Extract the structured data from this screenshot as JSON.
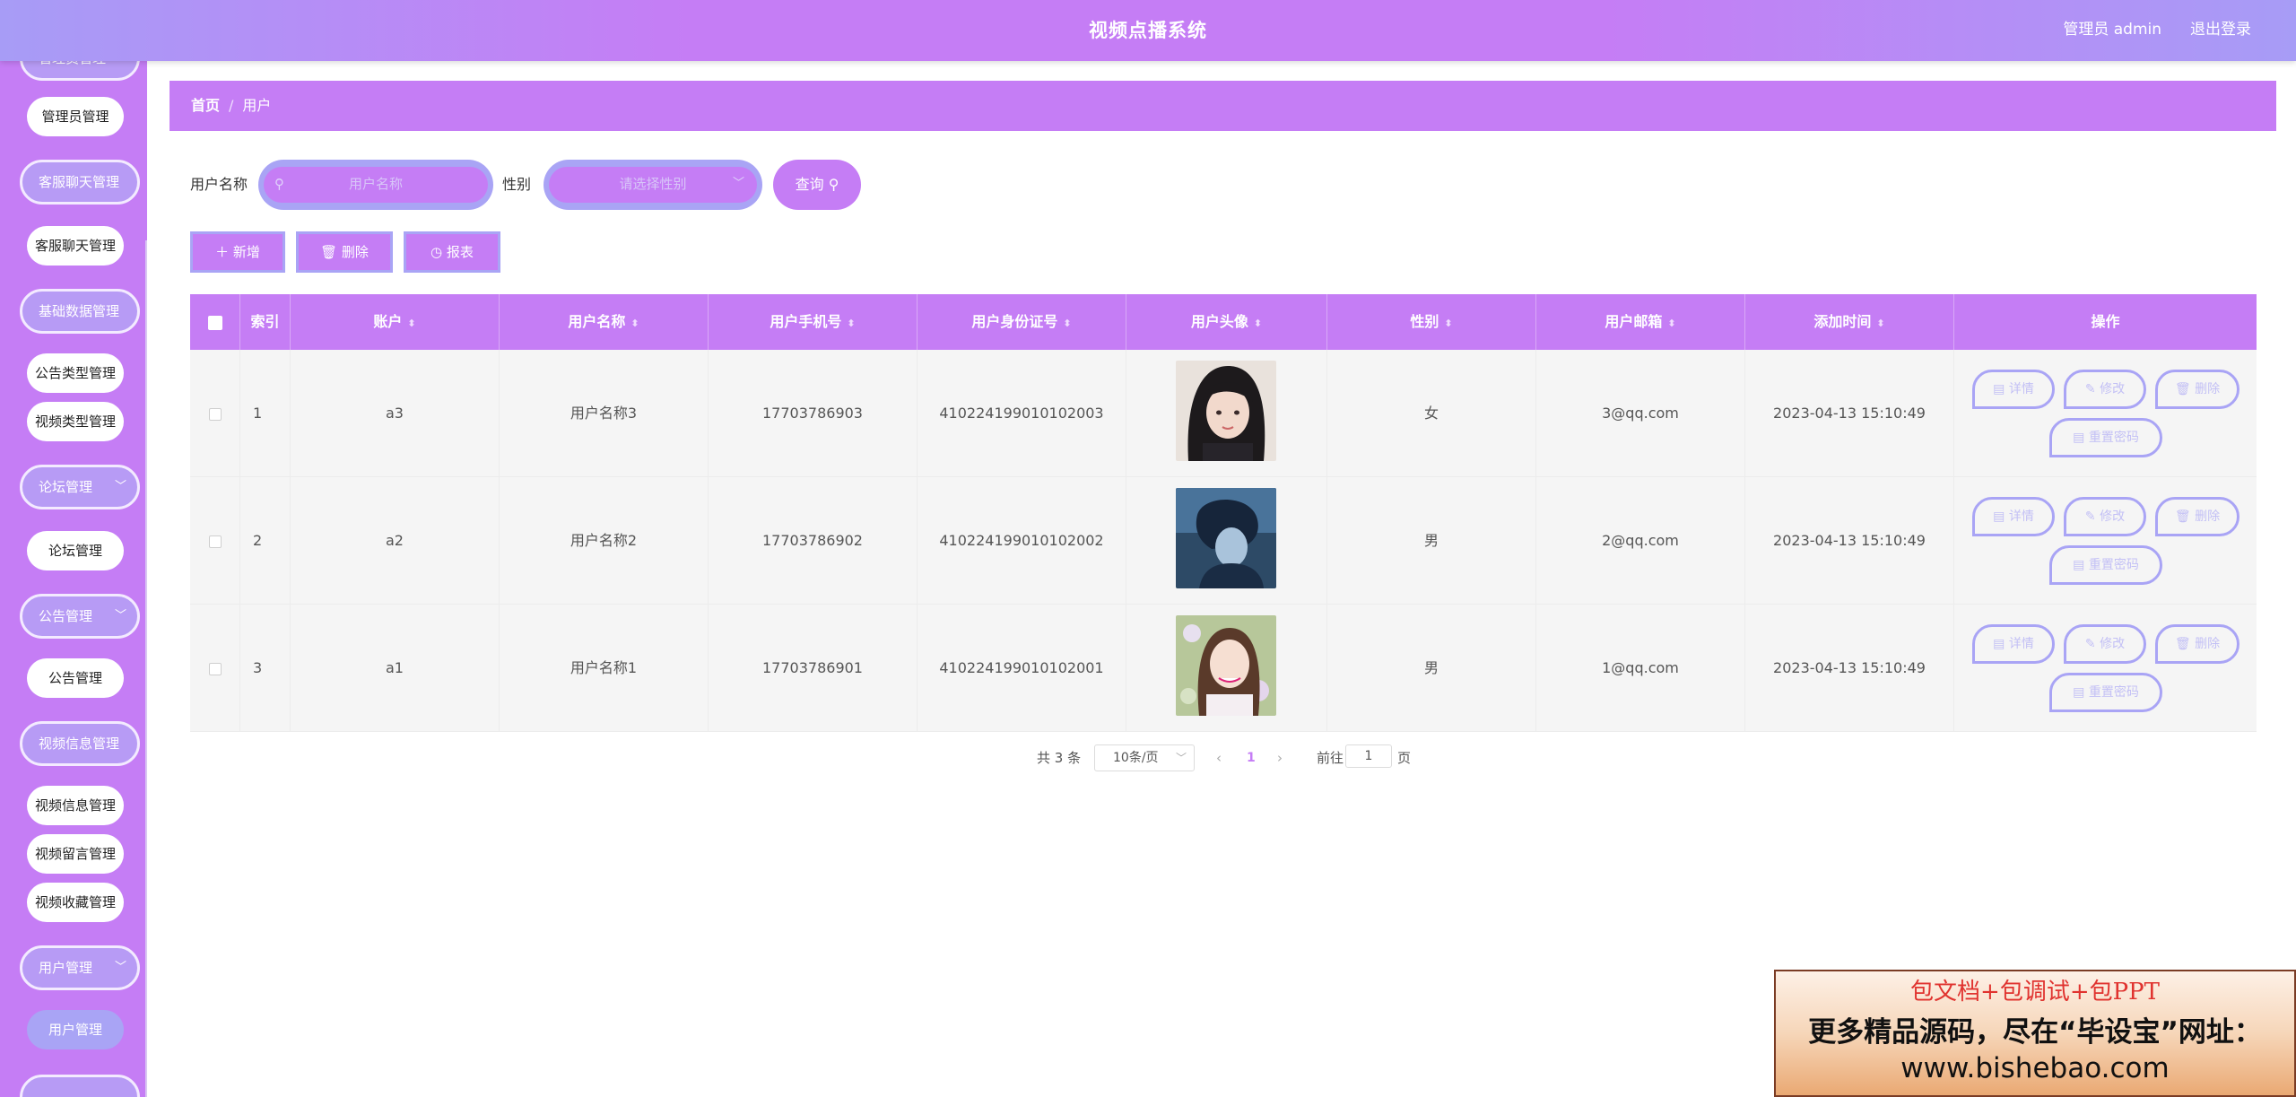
{
  "header": {
    "title": "视频点播系统",
    "user_label": "管理员 admin",
    "logout_label": "退出登录"
  },
  "sidebar": {
    "items": [
      {
        "type": "item",
        "label": "管理员管理"
      },
      {
        "type": "group",
        "label": "客服聊天管理"
      },
      {
        "type": "item",
        "label": "客服聊天管理"
      },
      {
        "type": "group",
        "label": "基础数据管理"
      },
      {
        "type": "item",
        "label": "公告类型管理"
      },
      {
        "type": "item",
        "label": "视频类型管理"
      },
      {
        "type": "group",
        "label": "论坛管理"
      },
      {
        "type": "item",
        "label": "论坛管理"
      },
      {
        "type": "group",
        "label": "公告管理"
      },
      {
        "type": "item",
        "label": "公告管理"
      },
      {
        "type": "group",
        "label": "视频信息管理"
      },
      {
        "type": "item",
        "label": "视频信息管理"
      },
      {
        "type": "item",
        "label": "视频留言管理"
      },
      {
        "type": "item",
        "label": "视频收藏管理"
      },
      {
        "type": "group",
        "label": "用户管理"
      },
      {
        "type": "item",
        "label": "用户管理",
        "active": true
      }
    ]
  },
  "breadcrumb": {
    "home": "首页",
    "separator": "/",
    "current": "用户"
  },
  "search": {
    "name_label": "用户名称",
    "name_placeholder": "用户名称",
    "gender_label": "性别",
    "gender_placeholder": "请选择性别",
    "query_label": "查询"
  },
  "actions": {
    "add_label": "新增",
    "delete_label": "删除",
    "report_label": "报表"
  },
  "table": {
    "headers": [
      "索引",
      "账户",
      "用户名称",
      "用户手机号",
      "用户身份证号",
      "用户头像",
      "性别",
      "用户邮箱",
      "添加时间",
      "操作"
    ],
    "op_labels": {
      "detail": "详情",
      "edit": "修改",
      "delete": "删除",
      "reset": "重置密码"
    },
    "rows": [
      {
        "index": "1",
        "account": "a3",
        "name": "用户名称3",
        "phone": "17703786903",
        "id_card": "410224199010102003",
        "gender": "女",
        "email": "3@qq.com",
        "created": "2023-04-13 15:10:49"
      },
      {
        "index": "2",
        "account": "a2",
        "name": "用户名称2",
        "phone": "17703786902",
        "id_card": "410224199010102002",
        "gender": "男",
        "email": "2@qq.com",
        "created": "2023-04-13 15:10:49"
      },
      {
        "index": "3",
        "account": "a1",
        "name": "用户名称1",
        "phone": "17703786901",
        "id_card": "410224199010102001",
        "gender": "男",
        "email": "1@qq.com",
        "created": "2023-04-13 15:10:49"
      }
    ]
  },
  "pagination": {
    "total": "共 3 条",
    "page_size": "10条/页",
    "current_page": "1",
    "goto_label": "前往",
    "goto_value": "1",
    "page_suffix": "页"
  },
  "ad": {
    "line1": "包文档+包调试+包PPT",
    "line2": "更多精品源码，尽在“毕设宝”网址：",
    "line3": "www.bishebao.com"
  },
  "colors": {
    "primary": "#c57df5",
    "secondary": "#a9a4f5",
    "header_gradient_edge": "#a79cf6"
  }
}
